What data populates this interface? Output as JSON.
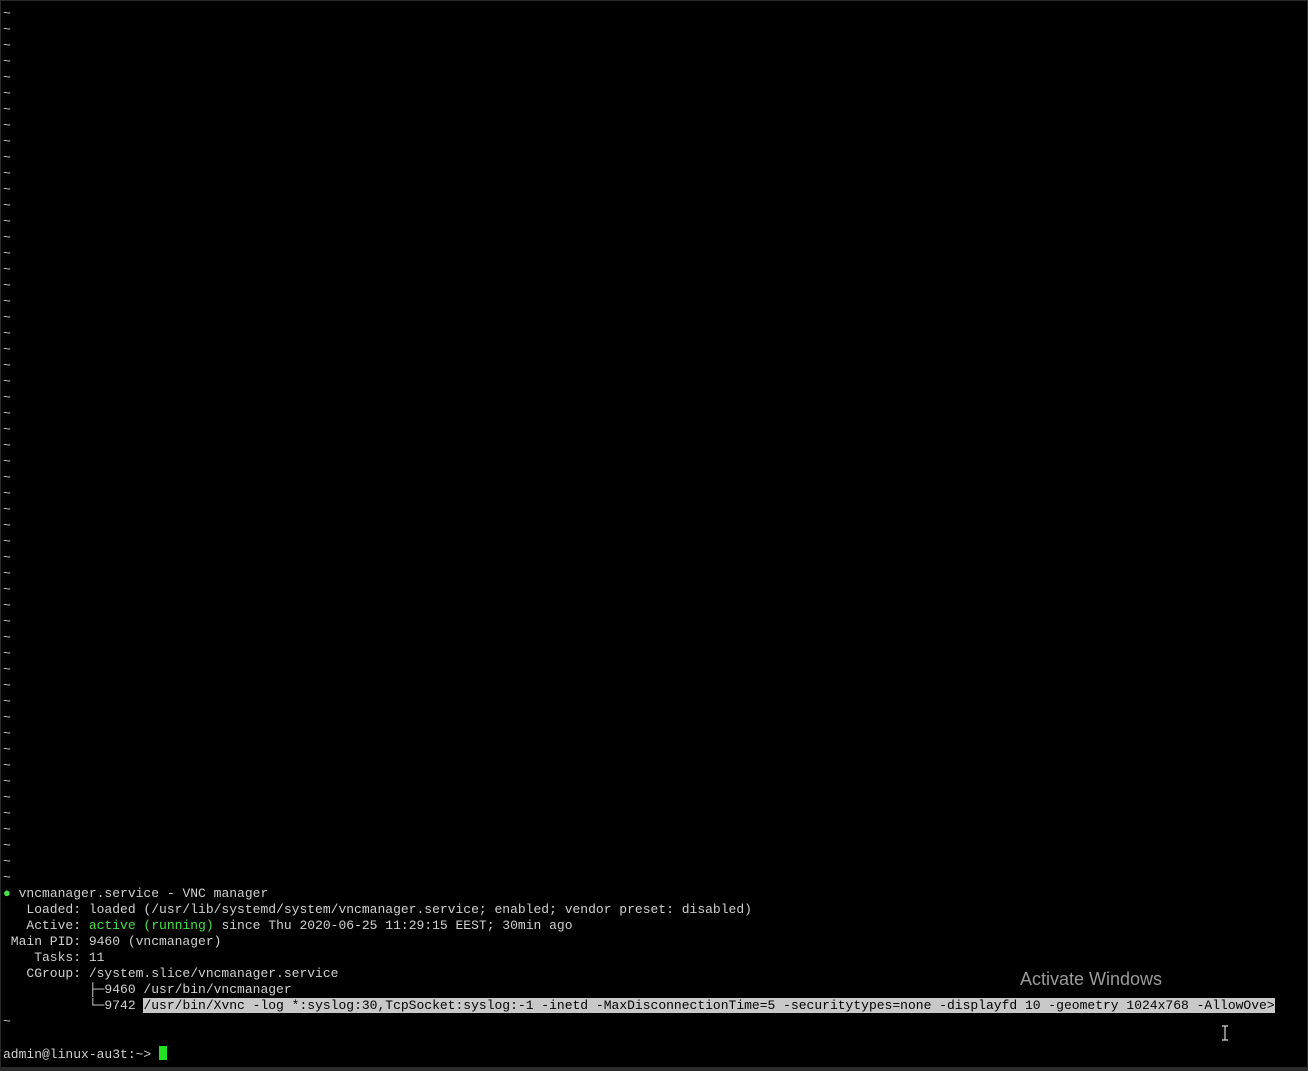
{
  "tilde_char": "~",
  "status": {
    "bullet": "●",
    "title": " vncmanager.service - VNC manager",
    "loaded": "   Loaded: loaded (/usr/lib/systemd/system/vncmanager.service; enabled; vendor preset: disabled)",
    "active_label": "   Active: ",
    "active_state": "active (running)",
    "active_since": " since Thu 2020-06-25 11:29:15 EEST; 30min ago",
    "main_pid": " Main PID: 9460 (vncmanager)",
    "tasks": "    Tasks: 11",
    "cgroup": "   CGroup: /system.slice/vncmanager.service",
    "proc1": "           ├─9460 /usr/bin/vncmanager",
    "proc2_prefix": "           └─9742 ",
    "proc2_cmd": "/usr/bin/Xvnc -log *:syslog:30,TcpSocket:syslog:-1 -inetd -MaxDisconnectionTime=5 -securitytypes=none -displayfd 10 -geometry 1024x768 -AllowOve>"
  },
  "prompt": "admin@linux-au3t:~> ",
  "watermark": "Activate Windows",
  "colors": {
    "background": "#000000",
    "text": "#d0d0d0",
    "active_green": "#46e046",
    "cursor_green": "#22e022",
    "selection": "#c8c8c8"
  }
}
